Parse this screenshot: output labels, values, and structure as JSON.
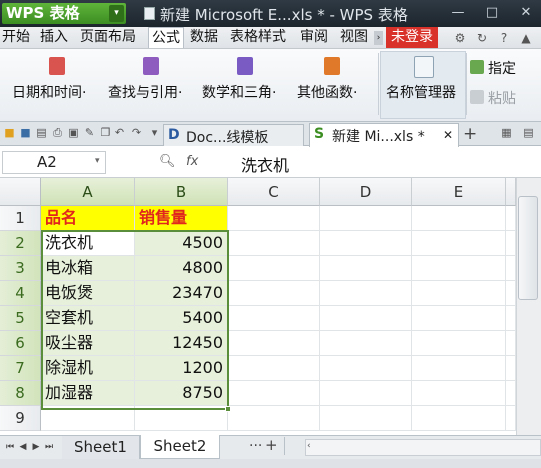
{
  "titlebar": {
    "app_name": "WPS 表格",
    "window_title": "新建 Microsoft E...xls * - WPS 表格",
    "controls": [
      "—",
      "□",
      "✕"
    ]
  },
  "menubar": {
    "items": [
      "开始",
      "插入",
      "页面布局",
      "公式",
      "数据",
      "表格样式",
      "审阅",
      "视图"
    ],
    "active": "公式",
    "login_label": "未登录"
  },
  "ribbon": {
    "groups": [
      {
        "label": "日期和时间",
        "color": "#d9534f"
      },
      {
        "label": "查找与引用",
        "color": "#8e5bbf"
      },
      {
        "label": "数学和三角",
        "color": "#7a5bc4"
      },
      {
        "label": "其他函数",
        "color": "#e07a2a"
      }
    ],
    "named_manager_label": "名称管理器",
    "specify_label": "指定",
    "paste_label": "粘贴"
  },
  "doc_tabs": {
    "template_tab": "Doc...线模板",
    "active_tab": "新建 Mi...xls *",
    "close_glyph": "✕",
    "add_glyph": "+"
  },
  "formula_bar": {
    "name_box_value": "A2",
    "fx_label": "fx",
    "content": "洗衣机"
  },
  "grid": {
    "columns": [
      "A",
      "B",
      "C",
      "D",
      "E"
    ],
    "rows": [
      "1",
      "2",
      "3",
      "4",
      "5",
      "6",
      "7",
      "8",
      "9"
    ],
    "header": {
      "a": "品名",
      "b": "销售量"
    },
    "data": [
      {
        "name": "洗衣机",
        "value": "4500"
      },
      {
        "name": "电冰箱",
        "value": "4800"
      },
      {
        "name": "电饭煲",
        "value": "23470"
      },
      {
        "name": "空套机",
        "value": "5400"
      },
      {
        "name": "吸尘器",
        "value": "12450"
      },
      {
        "name": "除湿机",
        "value": "1200"
      },
      {
        "name": "加湿器",
        "value": "8750"
      }
    ]
  },
  "sheets": {
    "tabs": [
      "Sheet1",
      "Sheet2"
    ],
    "active": "Sheet2",
    "more_label": "···",
    "add_label": "+"
  },
  "colors": {
    "accent_green": "#5b8e3b",
    "header_fill": "#ffff00",
    "header_text": "#e0261d",
    "login_red": "#d9322a"
  }
}
